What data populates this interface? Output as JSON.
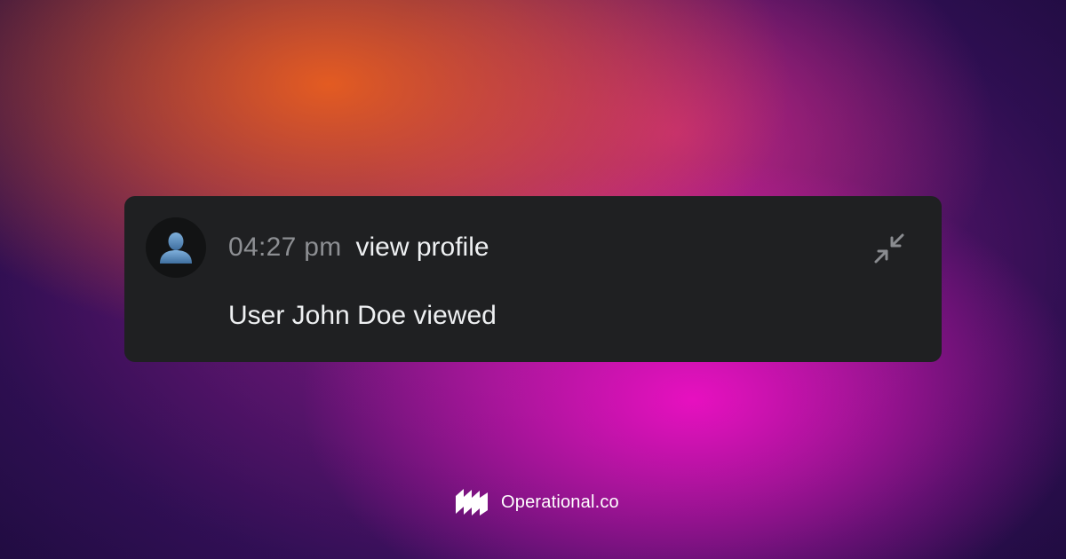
{
  "notification": {
    "time": "04:27 pm",
    "action": "view profile",
    "message": "User John Doe viewed",
    "avatar_icon": "user-silhouette-icon",
    "collapse_icon": "collapse-arrows-icon"
  },
  "brand": {
    "name": "Operational.co",
    "logo_icon": "operational-logo-icon"
  },
  "colors": {
    "card_background": "#1f2022",
    "time_text": "#8d8f93",
    "primary_text": "#eef0f2",
    "avatar_figure": "#5a8fc0",
    "gradient_orange": "#e85a20",
    "gradient_magenta": "#ee10c4",
    "gradient_deep_purple": "#1c0b3c"
  }
}
